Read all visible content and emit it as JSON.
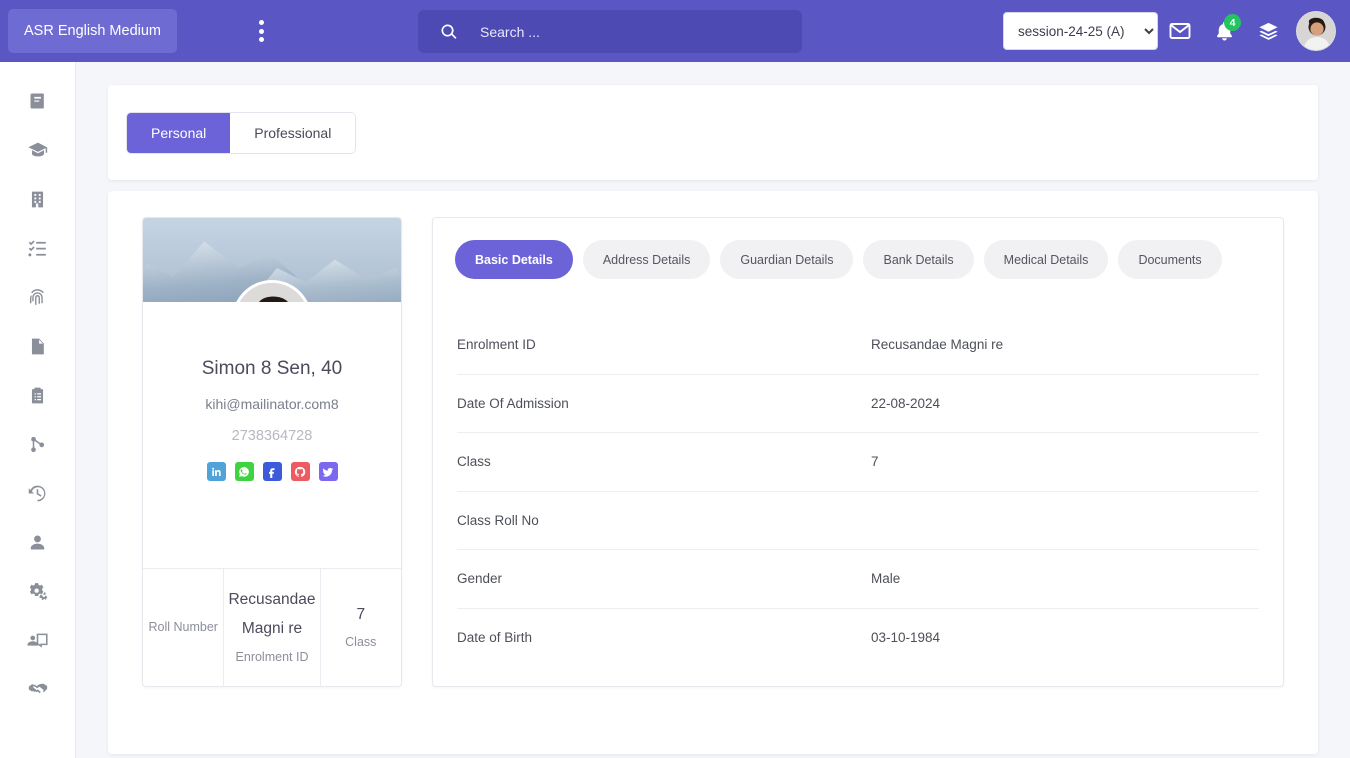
{
  "colors": {
    "header_purple": "#5a57c4",
    "brand_purple": "#6e6bd2",
    "accent_purple": "#6c63d8",
    "search_purple": "#4d4ab3",
    "content_bg": "#f5f6fa",
    "badge_green": "#22c55e"
  },
  "header": {
    "brand": "ASR English Medium",
    "menu_icon": "kebab-menu-icon",
    "search": {
      "placeholder": "Search ...",
      "value": "",
      "icon": "search-icon"
    },
    "session_select": {
      "selected": "session-24-25 (A)",
      "options": [
        "session-24-25 (A)"
      ]
    },
    "mail_icon": "envelope-icon",
    "bell_icon": "bell-icon",
    "notification_count": "4",
    "layers_icon": "layers-icon",
    "avatar": "user-avatar"
  },
  "sidebar": {
    "items": [
      {
        "icon": "book-icon",
        "name": "sidebar-item-book"
      },
      {
        "icon": "graduation-cap-icon",
        "name": "sidebar-item-academics"
      },
      {
        "icon": "building-icon",
        "name": "sidebar-item-building"
      },
      {
        "icon": "tasks-checklist-icon",
        "name": "sidebar-item-tasks"
      },
      {
        "icon": "fingerprint-icon",
        "name": "sidebar-item-attendance"
      },
      {
        "icon": "file-icon",
        "name": "sidebar-item-files"
      },
      {
        "icon": "clipboard-list-icon",
        "name": "sidebar-item-reports"
      },
      {
        "icon": "sitemap-icon",
        "name": "sidebar-item-structure"
      },
      {
        "icon": "history-clock-icon",
        "name": "sidebar-item-history"
      },
      {
        "icon": "user-icon",
        "name": "sidebar-item-users"
      },
      {
        "icon": "gears-icon",
        "name": "sidebar-item-settings"
      },
      {
        "icon": "user-screen-icon",
        "name": "sidebar-item-presentation"
      },
      {
        "icon": "handshake-icon",
        "name": "sidebar-item-handshake"
      }
    ]
  },
  "main": {
    "top_tabs": [
      {
        "label": "Personal",
        "active": true
      },
      {
        "label": "Professional",
        "active": false
      }
    ],
    "profile": {
      "name": "Simon 8 Sen, 40",
      "email": "kihi@mailinator.com8",
      "phone": "2738364728",
      "socials": [
        {
          "name": "linkedin-icon",
          "color": "#4fa3d9"
        },
        {
          "name": "whatsapp-icon",
          "color": "#3fd43f"
        },
        {
          "name": "facebook-icon",
          "color": "#3b5bdb"
        },
        {
          "name": "github-icon",
          "color": "#ee5a62"
        },
        {
          "name": "twitter-icon",
          "color": "#7b68ee"
        }
      ],
      "stats": [
        {
          "value": "",
          "label": "Roll Number"
        },
        {
          "value": "Recusandae Magni re",
          "label": "Enrolment ID"
        },
        {
          "value": "7",
          "label": "Class"
        }
      ]
    },
    "detail_tabs": [
      {
        "label": "Basic Details",
        "active": true
      },
      {
        "label": "Address Details",
        "active": false
      },
      {
        "label": "Guardian Details",
        "active": false
      },
      {
        "label": "Bank Details",
        "active": false
      },
      {
        "label": "Medical Details",
        "active": false
      },
      {
        "label": "Documents",
        "active": false
      }
    ],
    "basic_details": [
      {
        "key": "Enrolment ID",
        "value": "Recusandae Magni re"
      },
      {
        "key": "Date Of Admission",
        "value": "22-08-2024"
      },
      {
        "key": "Class",
        "value": "7"
      },
      {
        "key": "Class Roll No",
        "value": ""
      },
      {
        "key": "Gender",
        "value": "Male"
      },
      {
        "key": "Date of Birth",
        "value": "03-10-1984"
      }
    ]
  }
}
